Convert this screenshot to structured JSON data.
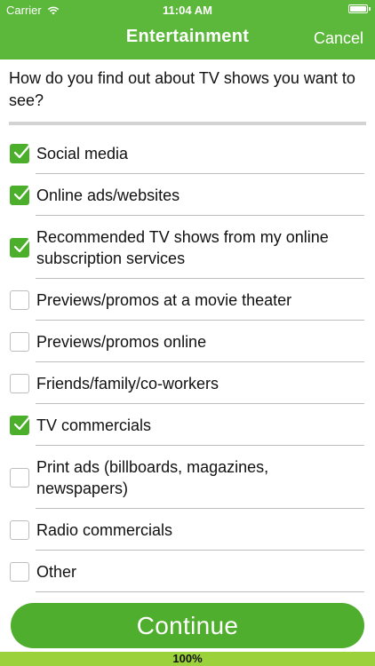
{
  "status_bar": {
    "carrier": "Carrier",
    "time": "11:04 AM"
  },
  "nav": {
    "title": "Entertainment",
    "cancel_label": "Cancel"
  },
  "question": "How do you find out about TV shows you want to see?",
  "options": [
    {
      "label": "Social media",
      "checked": true
    },
    {
      "label": "Online ads/websites",
      "checked": true
    },
    {
      "label": "Recommended TV shows from my online subscription services",
      "checked": true
    },
    {
      "label": "Previews/promos at a movie theater",
      "checked": false
    },
    {
      "label": "Previews/promos online",
      "checked": false
    },
    {
      "label": "Friends/family/co-workers",
      "checked": false
    },
    {
      "label": "TV commercials",
      "checked": true
    },
    {
      "label": "Print ads (billboards, magazines, newspapers)",
      "checked": false
    },
    {
      "label": "Radio commercials",
      "checked": false
    },
    {
      "label": "Other",
      "checked": false
    }
  ],
  "continue_label": "Continue",
  "progress": {
    "percent": 100,
    "label": "100%"
  },
  "colors": {
    "header": "#5cb83a",
    "checkbox": "#4caf2c",
    "button": "#4fae2d",
    "progress": "#9bd13a"
  }
}
